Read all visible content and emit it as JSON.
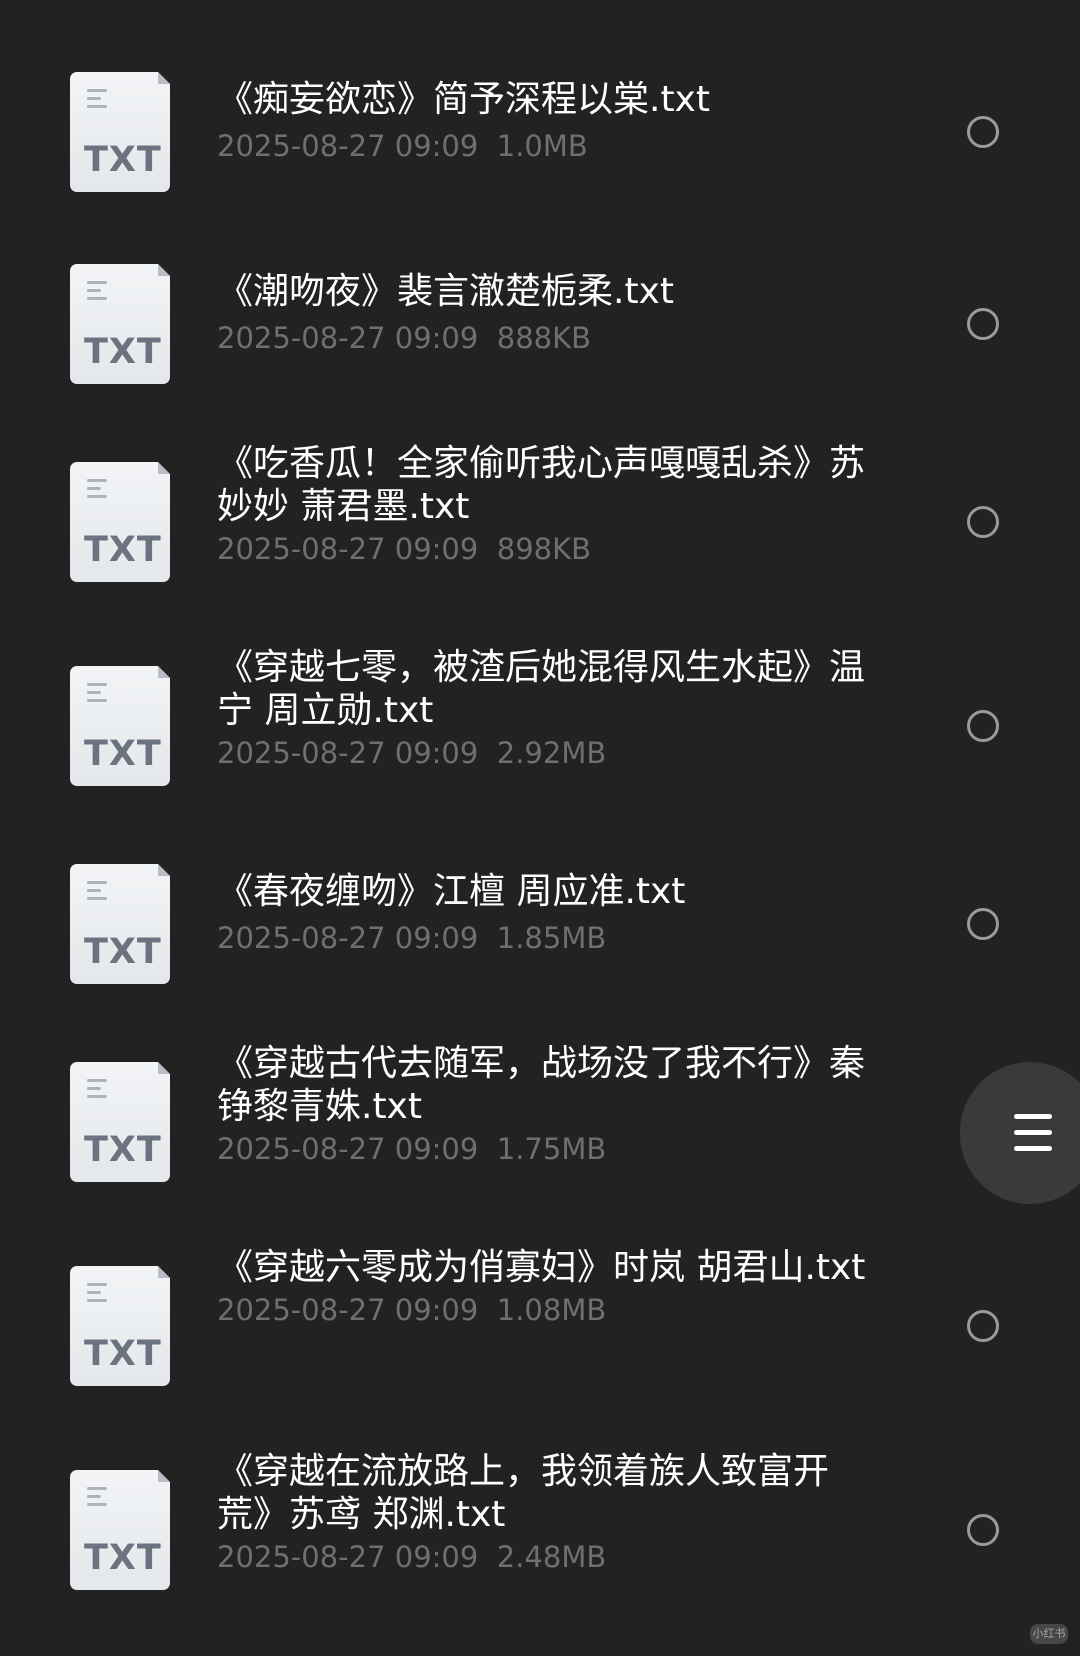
{
  "files": [
    {
      "icon_label": "TXT",
      "name": "《痴妄欲恋》简予深程以棠.txt",
      "date": "2025-08-27 09:09",
      "size": "1.0MB"
    },
    {
      "icon_label": "TXT",
      "name": "《潮吻夜》裴言澈楚栀柔.txt",
      "date": "2025-08-27 09:09",
      "size": "888KB"
    },
    {
      "icon_label": "TXT",
      "name": "《吃香瓜！全家偷听我心声嘎嘎乱杀》苏妙妙 萧君墨.txt",
      "date": "2025-08-27 09:09",
      "size": "898KB"
    },
    {
      "icon_label": "TXT",
      "name": "《穿越七零，被渣后她混得风生水起》温宁 周立勋.txt",
      "date": "2025-08-27 09:09",
      "size": "2.92MB"
    },
    {
      "icon_label": "TXT",
      "name": "《春夜缠吻》江檀 周应准.txt",
      "date": "2025-08-27 09:09",
      "size": "1.85MB"
    },
    {
      "icon_label": "TXT",
      "name": "《穿越古代去随军，战场没了我不行》秦铮黎青姝.txt",
      "date": "2025-08-27 09:09",
      "size": "1.75MB"
    },
    {
      "icon_label": "TXT",
      "name": "《穿越六零成为俏寡妇》时岚 胡君山.txt",
      "date": "2025-08-27 09:09",
      "size": "1.08MB"
    },
    {
      "icon_label": "TXT",
      "name": "《穿越在流放路上，我领着族人致富开荒》苏鸢 郑渊.txt",
      "date": "2025-08-27 09:09",
      "size": "2.48MB"
    }
  ],
  "icons": {
    "file": "txt-file-icon",
    "select": "radio-circle-icon",
    "menu": "hamburger-menu-icon"
  },
  "colors": {
    "background": "#222222",
    "name_text": "#ffffff",
    "meta_text": "#6f6f6f",
    "radio_border": "#9a9a9a",
    "fab_background": "#3a3a3a"
  },
  "watermark": "小红书"
}
